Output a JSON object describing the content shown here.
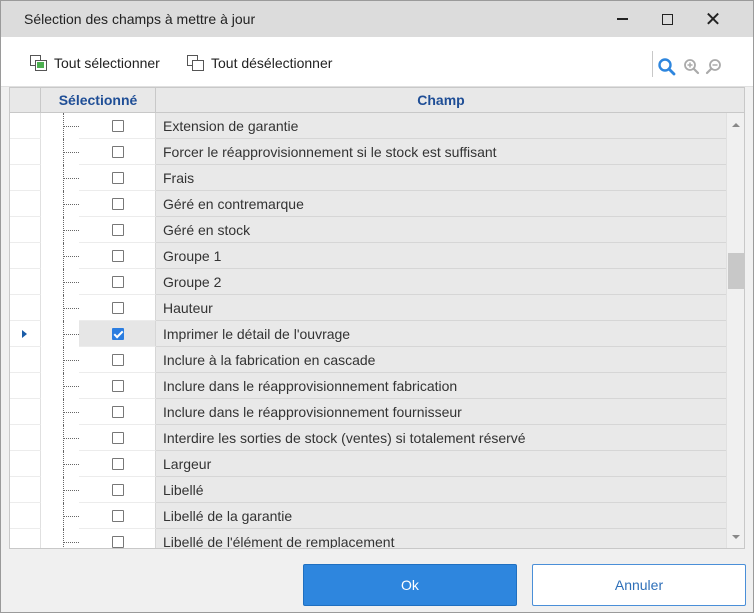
{
  "window": {
    "title": "Sélection des champs à mettre à jour",
    "min_label": "—",
    "max_label": "☐",
    "close_label": "✕"
  },
  "toolbar": {
    "select_all": "Tout sélectionner",
    "deselect_all": "Tout désélectionner",
    "icons": [
      "zoom-search-icon",
      "zoom-in-icon",
      "zoom-out-icon"
    ],
    "accent": "#2e86de"
  },
  "grid": {
    "headers": {
      "selected": "Sélectionné",
      "field": "Champ"
    },
    "rows": [
      {
        "label": "Extension de garantie",
        "checked": false,
        "current": false
      },
      {
        "label": "Forcer le réapprovisionnement si le stock est suffisant",
        "checked": false,
        "current": false
      },
      {
        "label": "Frais",
        "checked": false,
        "current": false
      },
      {
        "label": "Géré en contremarque",
        "checked": false,
        "current": false
      },
      {
        "label": "Géré en stock",
        "checked": false,
        "current": false
      },
      {
        "label": "Groupe 1",
        "checked": false,
        "current": false
      },
      {
        "label": "Groupe 2",
        "checked": false,
        "current": false
      },
      {
        "label": "Hauteur",
        "checked": false,
        "current": false
      },
      {
        "label": "Imprimer le détail de l'ouvrage",
        "checked": true,
        "current": true
      },
      {
        "label": "Inclure à la fabrication en cascade",
        "checked": false,
        "current": false
      },
      {
        "label": "Inclure dans le réapprovisionnement fabrication",
        "checked": false,
        "current": false
      },
      {
        "label": "Inclure dans le réapprovisionnement fournisseur",
        "checked": false,
        "current": false
      },
      {
        "label": "Interdire les sorties de stock (ventes) si totalement réservé",
        "checked": false,
        "current": false
      },
      {
        "label": "Largeur",
        "checked": false,
        "current": false
      },
      {
        "label": "Libellé",
        "checked": false,
        "current": false
      },
      {
        "label": "Libellé de la garantie",
        "checked": false,
        "current": false
      },
      {
        "label": "Libellé de l'élément de remplacement",
        "checked": false,
        "current": false
      }
    ]
  },
  "buttons": {
    "ok": "Ok",
    "cancel": "Annuler"
  }
}
